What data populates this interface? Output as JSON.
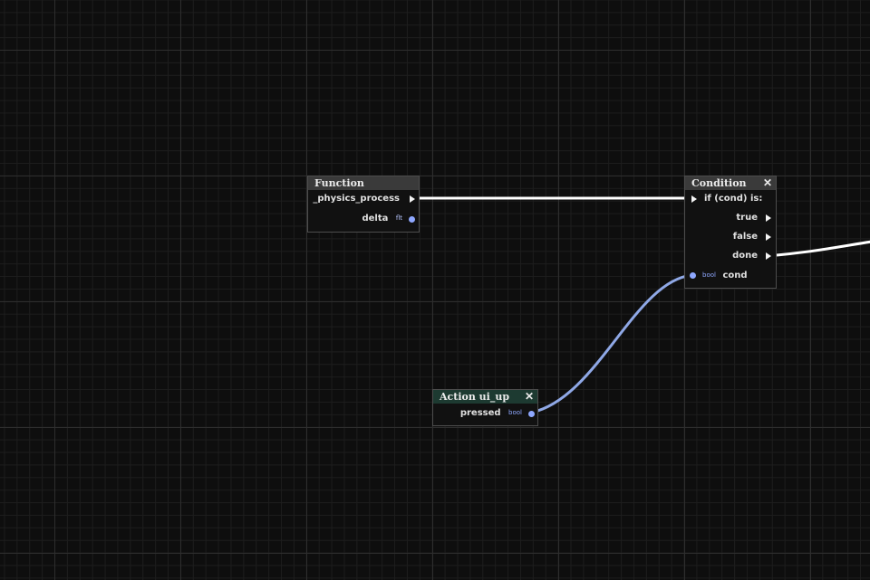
{
  "nodes": {
    "function": {
      "title": "Function",
      "exec_output_label": "_physics_process",
      "param_label": "delta",
      "param_type": "flt"
    },
    "condition": {
      "title": "Condition",
      "close_label": "✕",
      "exec_input_label": "if (cond) is:",
      "outputs": [
        {
          "label": "true"
        },
        {
          "label": "false"
        },
        {
          "label": "done"
        }
      ],
      "cond_input_type": "bool",
      "cond_input_label": "cond"
    },
    "action": {
      "title": "Action ui_up",
      "close_label": "✕",
      "output_label": "pressed",
      "output_type": "bool"
    }
  },
  "colors": {
    "exec_wire": "#ffffff",
    "bool_wire": "#8fa8e6",
    "function_header": "#3a3a3a",
    "action_header": "#1d3a31",
    "port_data": "#8fa8ff"
  }
}
